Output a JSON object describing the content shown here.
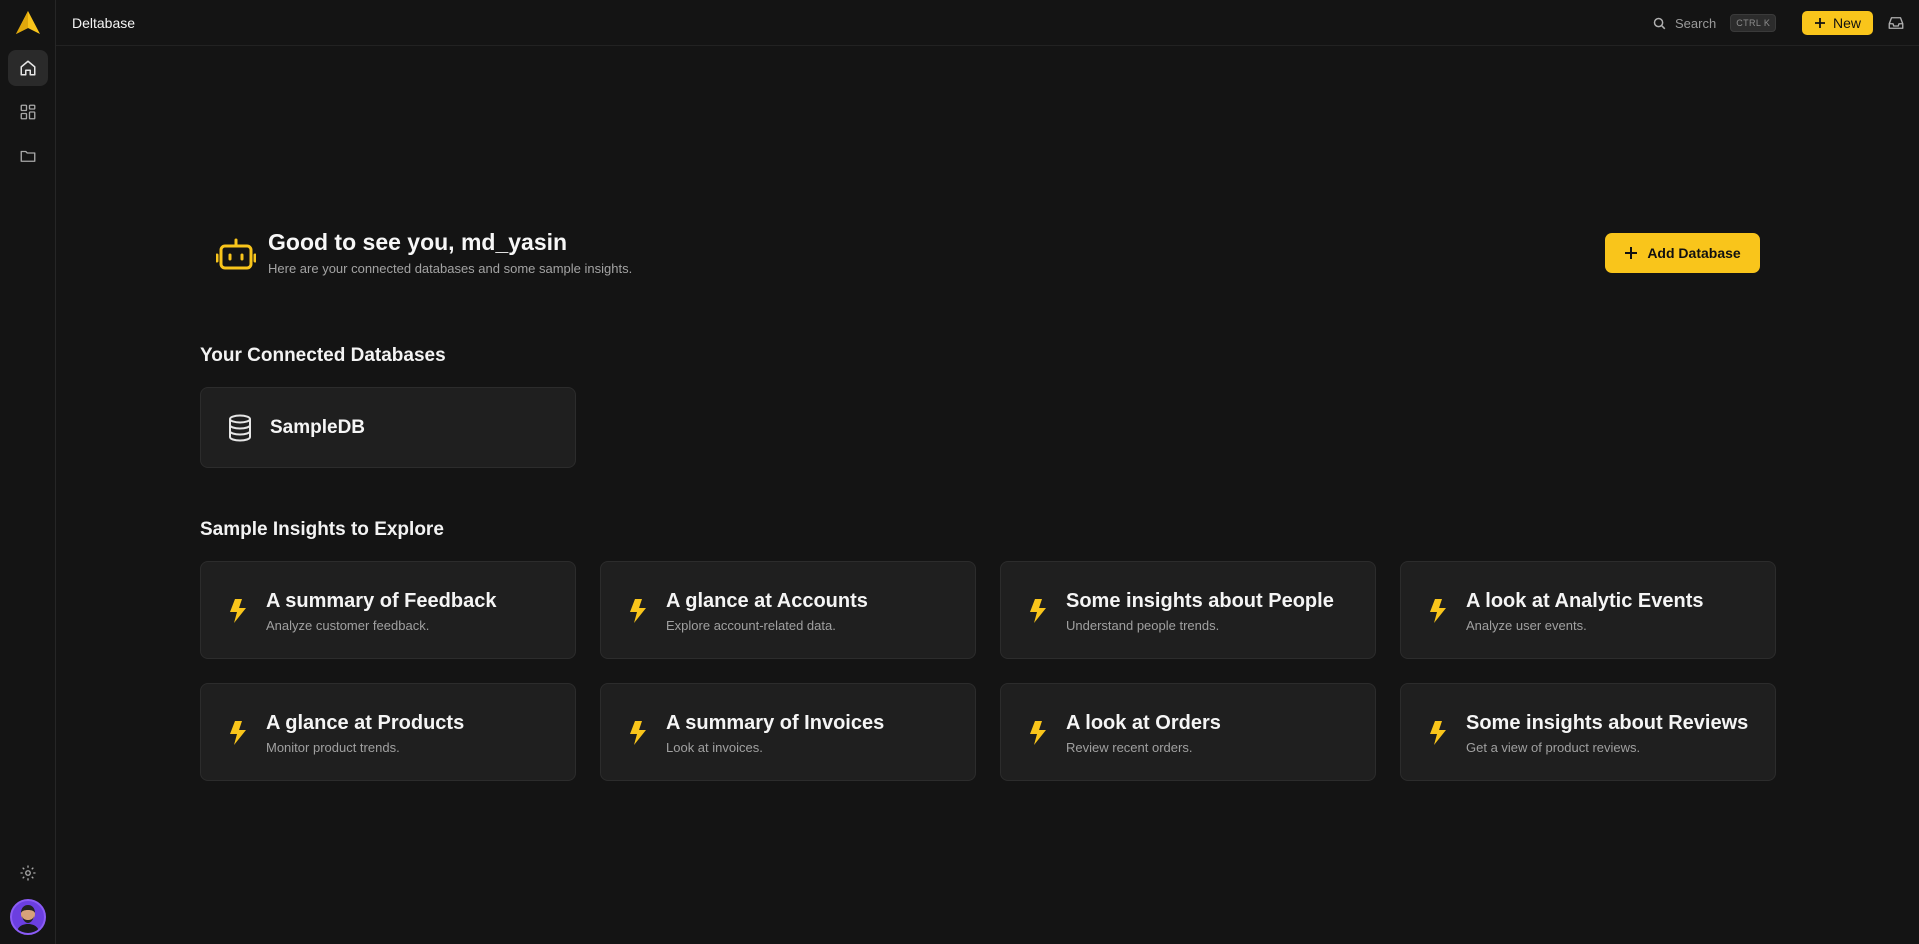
{
  "app": {
    "title": "Deltabase"
  },
  "topbar": {
    "search_label": "Search",
    "shortcut": "CTRL K",
    "new_label": "New"
  },
  "greeting": {
    "title": "Good to see you, md_yasin",
    "subtitle": "Here are your connected databases and some sample insights.",
    "add_button": "Add Database"
  },
  "databases": {
    "heading": "Your Connected Databases",
    "items": [
      {
        "name": "SampleDB"
      }
    ]
  },
  "insights": {
    "heading": "Sample Insights to Explore",
    "items": [
      {
        "title": "A summary of Feedback",
        "subtitle": "Analyze customer feedback."
      },
      {
        "title": "A glance at Accounts",
        "subtitle": "Explore account-related data."
      },
      {
        "title": "Some insights about People",
        "subtitle": "Understand people trends."
      },
      {
        "title": "A look at Analytic Events",
        "subtitle": "Analyze user events."
      },
      {
        "title": "A glance at Products",
        "subtitle": "Monitor product trends."
      },
      {
        "title": "A summary of Invoices",
        "subtitle": "Look at invoices."
      },
      {
        "title": "A look at Orders",
        "subtitle": "Review recent orders."
      },
      {
        "title": "Some insights about Reviews",
        "subtitle": "Get a view of product reviews."
      }
    ]
  },
  "colors": {
    "accent": "#f9c51b",
    "background": "#141414",
    "card": "#1f1f1f",
    "avatar": "#6b3fe0"
  },
  "icons": {
    "logo": "deltabase-logo-icon",
    "sidebar": [
      "home-icon",
      "dashboard-grid-icon",
      "folder-icon",
      "settings-gear-icon"
    ],
    "database": "database-icon",
    "insight": "lightning-bolt-icon",
    "greeting": "robot-icon"
  }
}
